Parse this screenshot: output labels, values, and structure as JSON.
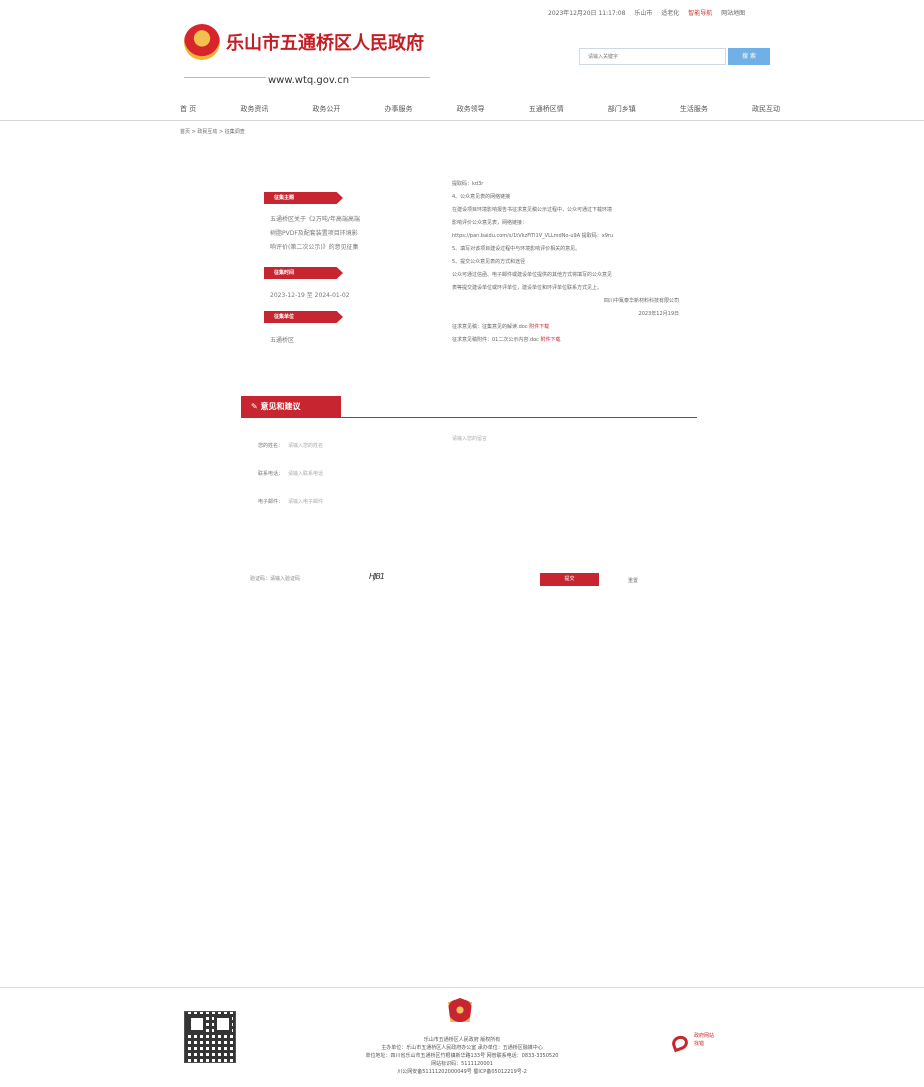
{
  "header": {
    "topbar": {
      "datetime": "2023年12月20日 11:17:08",
      "weather": "乐山市",
      "personalized": "适老化",
      "accessibility": "智能导航",
      "sitemap": "网站地图"
    },
    "site_title": "乐山市五通桥区人民政府",
    "domain": "www.wtq.gov.cn",
    "search": {
      "placeholder": "请输入关键字",
      "button": "搜 索"
    }
  },
  "nav": {
    "items": [
      "首 页",
      "政务资讯",
      "政务公开",
      "办事服务",
      "政务领导",
      "五通桥区情",
      "部门乡镇",
      "生活服务",
      "政民互动"
    ]
  },
  "breadcrumb": "首页 > 政民互动 > 征集调查",
  "left_panel": {
    "topic_label": "征集主题",
    "topic_lines": [
      "五通桥区关于《2万吨/年高端高端",
      "树脂PVDF及配套装置项目环境影",
      "响评价(第二次公示)》的意见征集"
    ],
    "time_label": "征集时间",
    "time_value": "2023-12-19 至 2024-01-02",
    "unit_label": "征集单位",
    "unit_value": "五通桥区"
  },
  "content": {
    "lines": [
      "提取码：kd3r",
      "4、公众意见表的网络链接",
      "在建设项目环境影响报告书征求意见稿公示过程中，公众可通过下载环境",
      "影响评价公众意见表，网络链接：",
      "https://pan.baidu.com/s/1tVkzFiTl1V_VLLmdNo-u9A 提取码：x9ru",
      "5、填写对该项目建设过程中与环境影响评价相关的意见。",
      "5、提交公众意见表的方式和途径",
      "公众可通过信函、电子邮件或建设单位提供的其他方式将填写的公众意见",
      "表等提交建设单位或环评单位，建设单位和环评单位联系方式见上。"
    ],
    "signature": "四川中氟泰华新材料科技有限公司",
    "date": "2023年12月19日",
    "attachment_1_prefix": "征求意见稿：征集意见的解读.doc",
    "attachment_1_link": "附件下载",
    "attachment_2_prefix": "征求意见稿附件：01二次公示内容.doc",
    "attachment_2_link": "附件下载"
  },
  "advice": {
    "title": "意见和建议",
    "name_label": "您的姓名：",
    "name_placeholder": "请输入您的姓名",
    "phone_label": "联系电话：",
    "phone_placeholder": "请输入联系电话",
    "email_label": "电子邮件：",
    "email_placeholder": "请输入电子邮件",
    "message_placeholder": "请输入您的留言",
    "captcha_label": "验证码：请输入验证码",
    "captcha_text": "HJB1",
    "submit": "提交",
    "reset": "重置"
  },
  "footer": {
    "owner": "乐山市五通桥区人民政府 版权所有",
    "sponsor": "主办单位：乐山市五通桥区人民政府办公室    承办单位：五通桥区融媒中心",
    "address": "单位地址：四川省乐山市五通桥区竹根镇新华路133号    网管联系电话：0833-3350520",
    "site_id": "网站标识码：5111120001",
    "icp": "川公网安备51111202000049号 蜀ICP备05012219号-2",
    "gov_badge_1": "政府网站",
    "gov_badge_2": "找错"
  }
}
